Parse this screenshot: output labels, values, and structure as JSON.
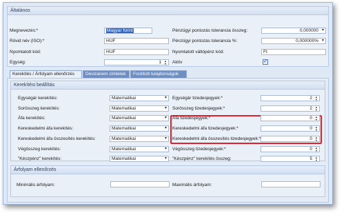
{
  "general": {
    "title": "Általános",
    "name_label": "Megnevezés:*",
    "name_value": "Magyar forint",
    "short_label": "Rövid név (ISO):*",
    "short_value": "HUF",
    "print_label": "Nyomtatott kód:",
    "print_value": "HUF",
    "unit_label": "Egység:",
    "unit_value": "1",
    "tol_amount_label": "Pénzügyi pontozás tolerancia összeg:",
    "tol_amount_value": "0,000000",
    "tol_pct_label": "Pénzügyi pontozás tolerancia %:",
    "tol_pct_value": "0,000000%",
    "change_label": "Nyomtatott váltópénz kód:",
    "change_value": "Ft",
    "active_label": "Aktív",
    "active_checked": true
  },
  "tabs": [
    {
      "label": "Kerekítés / Árfolyam ellenőrzés"
    },
    {
      "label": "Devizanem címletek"
    },
    {
      "label": "Fordított tulajdonságok"
    }
  ],
  "rounding": {
    "title": "Kerekítési beállítás",
    "rows_left": [
      {
        "label": "Egységár kerekítés:",
        "value": "Matematikai"
      },
      {
        "label": "Sorösszeg kerekítés:",
        "value": "Matematikai"
      },
      {
        "label": "Áfa kerekítés:",
        "value": "Matematikai"
      },
      {
        "label": "Kereskedelmi áfa kerekítés:",
        "value": "Matematikai"
      },
      {
        "label": "Kereskedelmi áfa összesítés kerekítés:",
        "value": "Matematikai"
      },
      {
        "label": "Végösszeg kerekítés:",
        "value": "Matematikai"
      },
      {
        "label": "\"Készpénz\" kerekítés:",
        "value": "Matematikai"
      }
    ],
    "rows_right": [
      {
        "label": "Egységár tizedesjegyek:*",
        "value": "2"
      },
      {
        "label": "Sorösszeg tizedesjegyek:*",
        "value": "2"
      },
      {
        "label": "Áfa tizedesjegyek:*",
        "value": "0"
      },
      {
        "label": "Kereskedelmi áfa tizedesjegyek:*",
        "value": "0"
      },
      {
        "label": "Kereskedelmi áfa összesítés tizedesjegyek:*",
        "value": "0"
      },
      {
        "label": "Végösszeg tizedesjegyek:*",
        "value": "0"
      },
      {
        "label": "\"Készpénz\" kerekítés összeg:",
        "value": "5"
      }
    ]
  },
  "rate": {
    "title": "Árfolyam ellenőrzés",
    "min_label": "Minimális árfolyam:",
    "min_value": "",
    "max_label": "Maximális árfolyam:",
    "max_value": ""
  },
  "colors": {
    "highlight_box": "#e0202a",
    "selected_text_bg": "#3165c4"
  }
}
